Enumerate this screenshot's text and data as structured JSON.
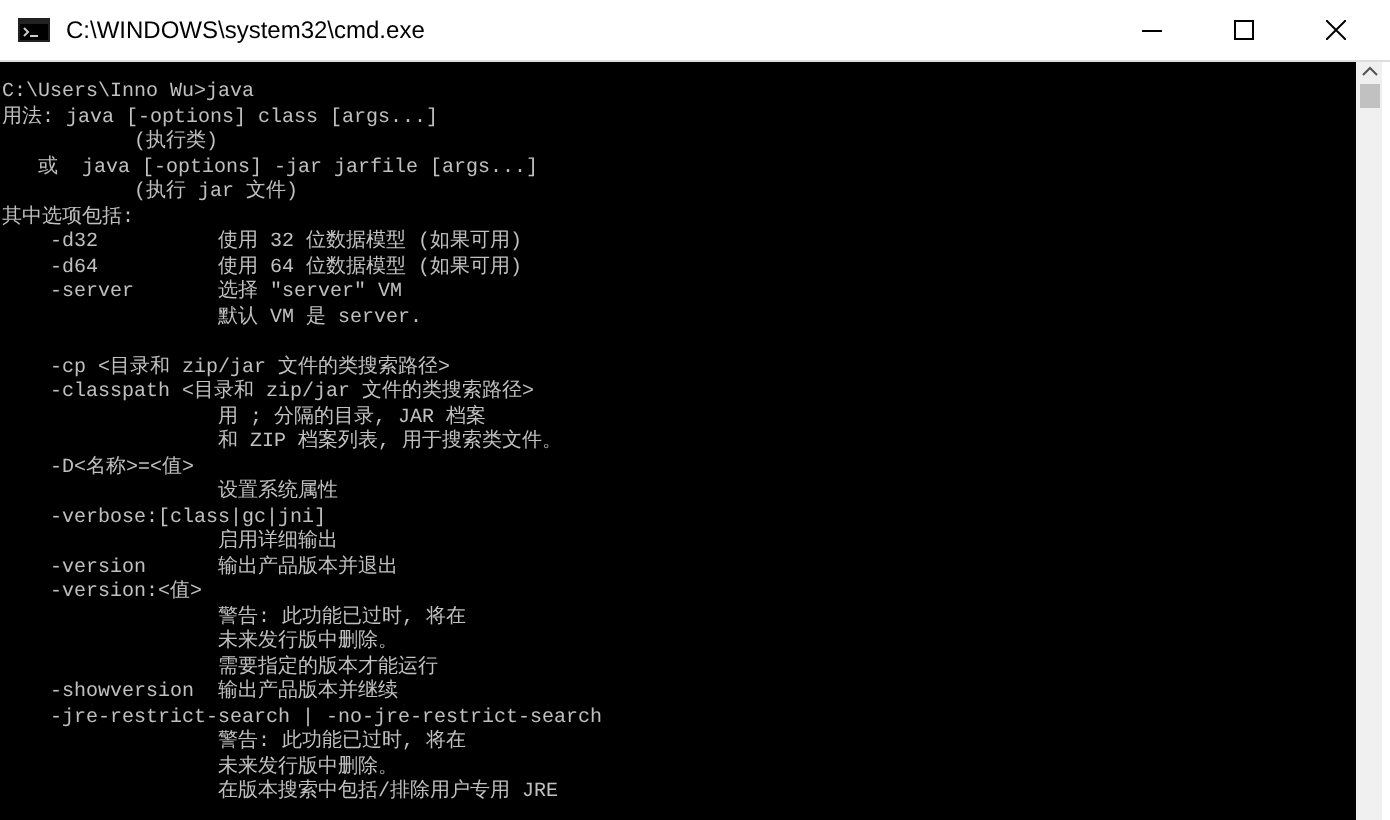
{
  "window": {
    "title": "C:\\WINDOWS\\system32\\cmd.exe"
  },
  "console": {
    "lines": [
      {
        "kind": "text",
        "text": "C:\\Users\\Inno Wu>java"
      },
      {
        "kind": "text",
        "text": "用法: java [-options] class [args...]"
      },
      {
        "kind": "text",
        "text": "           (执行类)"
      },
      {
        "kind": "text",
        "text": "   或  java [-options] -jar jarfile [args...]"
      },
      {
        "kind": "text",
        "text": "           (执行 jar 文件)"
      },
      {
        "kind": "text",
        "text": "其中选项包括:"
      },
      {
        "kind": "text",
        "text": "    -d32          使用 32 位数据模型 (如果可用)"
      },
      {
        "kind": "text",
        "text": "    -d64          使用 64 位数据模型 (如果可用)"
      },
      {
        "kind": "text",
        "text": "    -server       选择 \"server\" VM"
      },
      {
        "kind": "text",
        "text": "                  默认 VM 是 server."
      },
      {
        "kind": "blank"
      },
      {
        "kind": "text",
        "text": "    -cp <目录和 zip/jar 文件的类搜索路径>"
      },
      {
        "kind": "text",
        "text": "    -classpath <目录和 zip/jar 文件的类搜索路径>"
      },
      {
        "kind": "text",
        "text": "                  用 ; 分隔的目录, JAR 档案"
      },
      {
        "kind": "text",
        "text": "                  和 ZIP 档案列表, 用于搜索类文件。"
      },
      {
        "kind": "text",
        "text": "    -D<名称>=<值>"
      },
      {
        "kind": "text",
        "text": "                  设置系统属性"
      },
      {
        "kind": "text",
        "text": "    -verbose:[class|gc|jni]"
      },
      {
        "kind": "text",
        "text": "                  启用详细输出"
      },
      {
        "kind": "text",
        "text": "    -version      输出产品版本并退出"
      },
      {
        "kind": "text",
        "text": "    -version:<值>"
      },
      {
        "kind": "text",
        "text": "                  警告: 此功能已过时, 将在"
      },
      {
        "kind": "text",
        "text": "                  未来发行版中删除。"
      },
      {
        "kind": "text",
        "text": "                  需要指定的版本才能运行"
      },
      {
        "kind": "text",
        "text": "    -showversion  输出产品版本并继续"
      },
      {
        "kind": "text",
        "text": "    -jre-restrict-search | -no-jre-restrict-search"
      },
      {
        "kind": "text",
        "text": "                  警告: 此功能已过时, 将在"
      },
      {
        "kind": "text",
        "text": "                  未来发行版中删除。"
      },
      {
        "kind": "text",
        "text": "                  在版本搜索中包括/排除用户专用 JRE"
      }
    ]
  }
}
